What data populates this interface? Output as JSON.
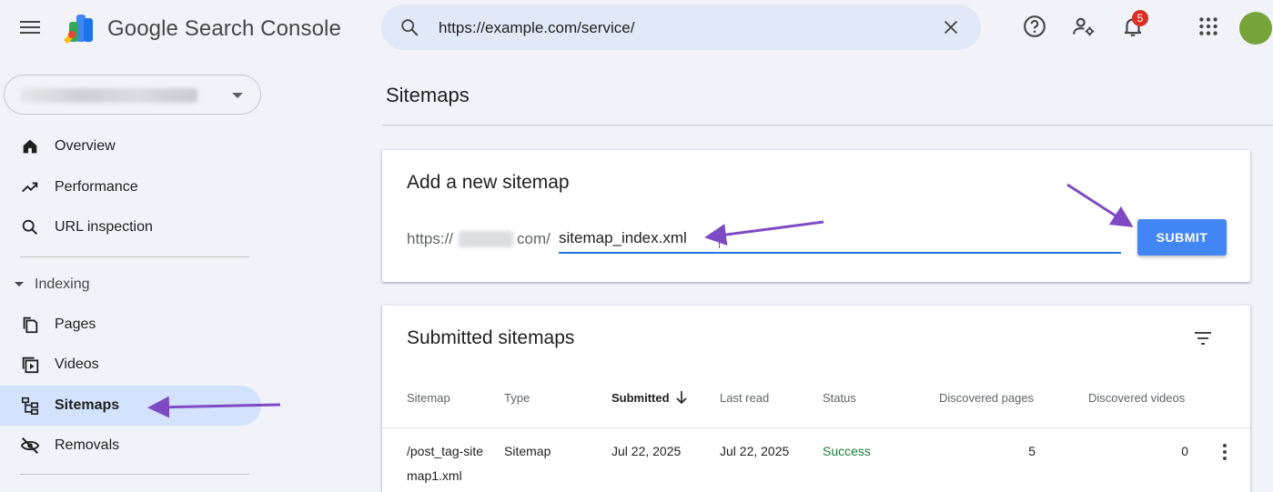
{
  "app": {
    "brand_name": "Google Search Console",
    "search_value": "https://example.com/service/",
    "notification_count": "5",
    "icons": {
      "menu": "menu-icon",
      "search": "search-icon",
      "clear": "close-icon",
      "help": "help-icon",
      "account_settings": "account-settings-icon",
      "notifications": "bell-icon",
      "apps": "apps-grid-icon"
    },
    "colors": {
      "accent": "#4285f4",
      "active_nav": "#d3e3fd",
      "success": "#188038",
      "badge": "#d93025",
      "annotation_arrow": "#7e4ac4"
    }
  },
  "sidebar": {
    "items_top": [
      {
        "label": "Overview",
        "icon": "home-icon"
      },
      {
        "label": "Performance",
        "icon": "trending-up-icon"
      },
      {
        "label": "URL inspection",
        "icon": "search-icon"
      }
    ],
    "section": {
      "label": "Indexing"
    },
    "items_indexing": [
      {
        "label": "Pages",
        "icon": "pages-icon"
      },
      {
        "label": "Videos",
        "icon": "video-icon"
      },
      {
        "label": "Sitemaps",
        "icon": "sitemap-icon",
        "active": true
      },
      {
        "label": "Removals",
        "icon": "visibility-off-icon"
      }
    ]
  },
  "main": {
    "page_title": "Sitemaps",
    "add_card": {
      "title": "Add a new sitemap",
      "prefix_start": "https://",
      "prefix_end": "com/",
      "input_value": "sitemap_index.xml",
      "submit_label": "SUBMIT"
    },
    "submitted_card": {
      "title": "Submitted sitemaps",
      "columns": [
        "Sitemap",
        "Type",
        "Submitted",
        "Last read",
        "Status",
        "Discovered pages",
        "Discovered videos"
      ],
      "sorted_column": "Submitted",
      "rows": [
        {
          "sitemap": "/post_tag-sitemap1.xml",
          "type": "Sitemap",
          "submitted": "Jul 22, 2025",
          "last_read": "Jul 22, 2025",
          "status": "Success",
          "discovered_pages": "5",
          "discovered_videos": "0"
        }
      ]
    }
  }
}
